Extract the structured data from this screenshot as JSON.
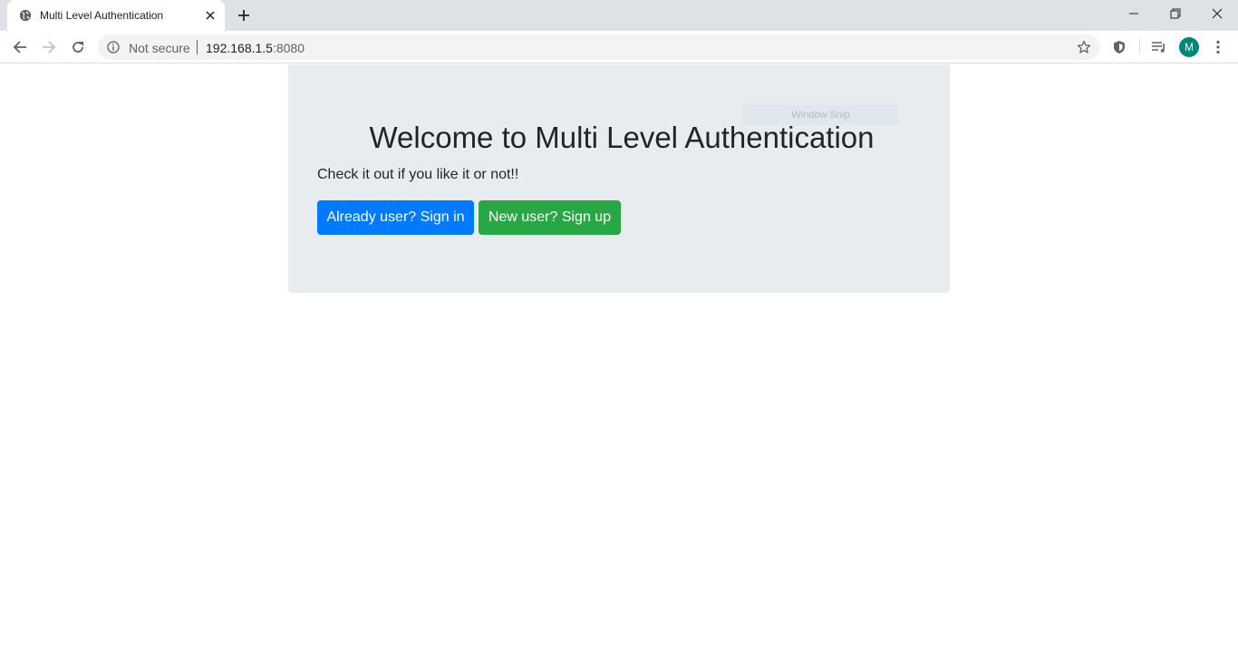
{
  "browser": {
    "tab_title": "Multi Level Authentication",
    "security_label": "Not secure",
    "url_host": "192.168.1.5",
    "url_port": ":8080",
    "profile_initial": "M"
  },
  "page": {
    "snip_label": "Window Snip",
    "heading": "Welcome to Multi Level Authentication",
    "lead": "Check it out if you like it or not!!",
    "signin_button": "Already user? Sign in",
    "signup_button": "New user? Sign up"
  },
  "colors": {
    "primary": "#007bff",
    "success": "#28a745",
    "jumbotron_bg": "#e9ecef",
    "avatar_bg": "#00897b"
  },
  "icons": [
    "globe-icon",
    "close-icon",
    "plus-icon",
    "minimize-icon",
    "restore-icon",
    "window-close-icon",
    "back-arrow-icon",
    "forward-arrow-icon",
    "reload-icon",
    "info-icon",
    "star-icon",
    "shield-icon",
    "media-queue-icon",
    "more-vert-icon"
  ]
}
